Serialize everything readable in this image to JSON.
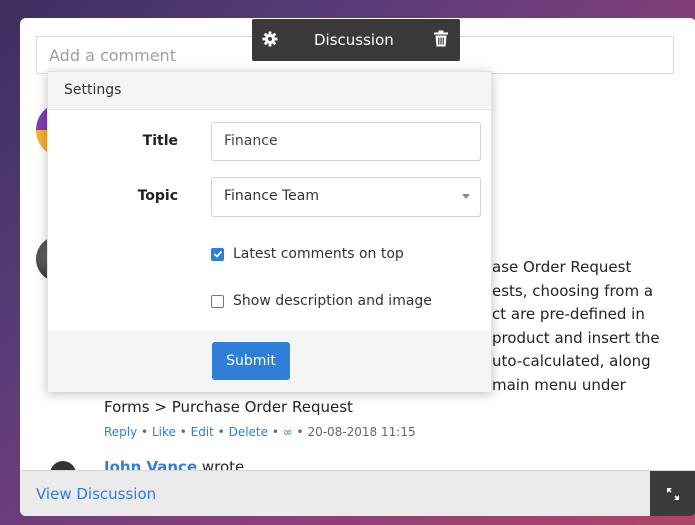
{
  "comment_box": {
    "placeholder": "Add a comment"
  },
  "toolbar": {
    "title": "Discussion",
    "gear_icon": "gear-icon",
    "trash_icon": "trash-icon"
  },
  "background": {
    "text_lines": [
      "ase Order Request",
      "ests, choosing from a",
      "ct are pre-defined in",
      "product and insert the",
      "uto-calculated, along",
      "main menu under"
    ],
    "forms_line": "Forms > Purchase Order Request",
    "meta": {
      "reply": "Reply",
      "like": "Like",
      "edit": "Edit",
      "delete": "Delete",
      "link_icon": "∞",
      "sep": " • ",
      "date": "20-08-2018 11:15"
    },
    "next_author": "John Vance",
    "next_author_suffix": " wrote"
  },
  "settings_panel": {
    "header": "Settings",
    "title_label": "Title",
    "title_value": "Finance",
    "topic_label": "Topic",
    "topic_value": "Finance Team",
    "latest_on_top_label": "Latest comments on top",
    "latest_on_top_checked": true,
    "show_desc_label": "Show description and image",
    "show_desc_checked": false,
    "submit_label": "Submit"
  },
  "footer": {
    "view_label": "View Discussion",
    "expand_icon": "expand-icon"
  },
  "colors": {
    "accent": "#2f7ed8",
    "toolbar_bg": "#3a3a3a"
  }
}
